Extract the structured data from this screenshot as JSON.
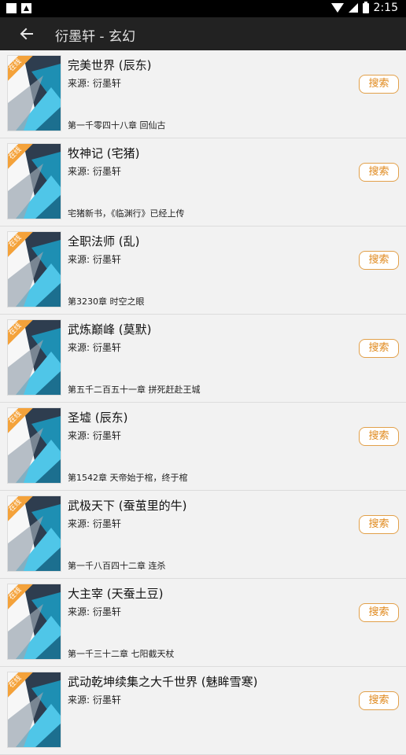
{
  "status_bar": {
    "time": "2:15"
  },
  "app_bar": {
    "title": "衍墨轩 - 玄幻"
  },
  "colors": {
    "accent": "#e08a1e",
    "appbar": "#222222",
    "tag": "#f4a23a"
  },
  "books": [
    {
      "title": "完美世界 (辰东)",
      "source": "来源: 衍墨轩",
      "latest": "第一千零四十八章 回仙古",
      "button": "搜索",
      "tag": "在线"
    },
    {
      "title": "牧神记 (宅猪)",
      "source": "来源: 衍墨轩",
      "latest": "宅猪新书，《临渊行》已经上传",
      "button": "搜索",
      "tag": "在线"
    },
    {
      "title": "全职法师 (乱)",
      "source": "来源: 衍墨轩",
      "latest": "第3230章 时空之眼",
      "button": "搜索",
      "tag": "在线"
    },
    {
      "title": "武炼巅峰 (莫默)",
      "source": "来源: 衍墨轩",
      "latest": "第五千二百五十一章 拼死赶赴王城",
      "button": "搜索",
      "tag": "在线"
    },
    {
      "title": "圣墟 (辰东)",
      "source": "来源: 衍墨轩",
      "latest": "第1542章 天帝始于棺，终于棺",
      "button": "搜索",
      "tag": "在线"
    },
    {
      "title": "武极天下 (蚕茧里的牛)",
      "source": "来源: 衍墨轩",
      "latest": "第一千八百四十二章 连杀",
      "button": "搜索",
      "tag": "在线"
    },
    {
      "title": "大主宰 (天蚕土豆)",
      "source": "来源: 衍墨轩",
      "latest": "第一千三十二章 七阳截天杖",
      "button": "搜索",
      "tag": "在线"
    },
    {
      "title": "武动乾坤续集之大千世界 (魅眸雪寒)",
      "source": "来源: 衍墨轩",
      "latest": "",
      "button": "搜索",
      "tag": "在线"
    }
  ]
}
